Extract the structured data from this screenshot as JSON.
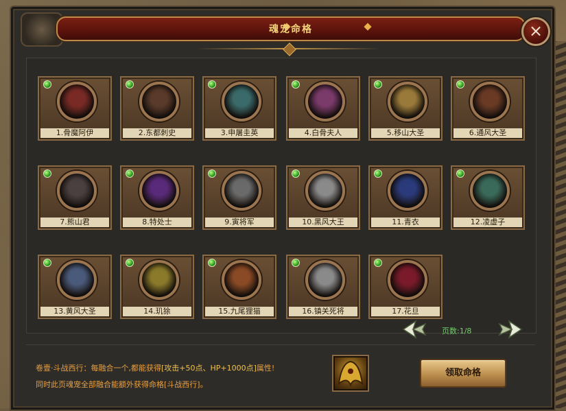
{
  "window": {
    "title": "魂宠命格",
    "close_symbol": "×"
  },
  "pets": [
    {
      "label": "1.骨魔阿伊",
      "color": "#7a2a25"
    },
    {
      "label": "2.东都刺史",
      "color": "#5a3a2a"
    },
    {
      "label": "3.申屠圭英",
      "color": "#3a6a6a"
    },
    {
      "label": "4.白骨夫人",
      "color": "#7a3a6a"
    },
    {
      "label": "5.移山大圣",
      "color": "#9a7a3a"
    },
    {
      "label": "6.通风大圣",
      "color": "#6a3a25"
    },
    {
      "label": "7.熊山君",
      "color": "#4a4040"
    },
    {
      "label": "8.特处士",
      "color": "#5a2a7a"
    },
    {
      "label": "9.寅将军",
      "color": "#6a6a6a"
    },
    {
      "label": "10.黑风大王",
      "color": "#8a8a8a"
    },
    {
      "label": "11.青衣",
      "color": "#2a3a7a"
    },
    {
      "label": "12.凌虚子",
      "color": "#3a6a5a"
    },
    {
      "label": "13.黄风大圣",
      "color": "#4a5a7a"
    },
    {
      "label": "14.玑狳",
      "color": "#8a7a2a"
    },
    {
      "label": "15.九尾狸猫",
      "color": "#8a4a25"
    },
    {
      "label": "16.镇关死将",
      "color": "#8a8a8a"
    },
    {
      "label": "17.花旦",
      "color": "#7a1a2a"
    }
  ],
  "pagination": {
    "label": "页数:1/8"
  },
  "info": {
    "line1_prefix": "卷壹·斗战西行：每融合一个,都能获得",
    "line1_bonus": "[攻击+50点、HP+1000点]",
    "line1_suffix": "属性!",
    "line2": "同时此页魂宠全部融合能额外获得命格[斗战西行]。"
  },
  "claim_button": {
    "label": "领取命格"
  }
}
